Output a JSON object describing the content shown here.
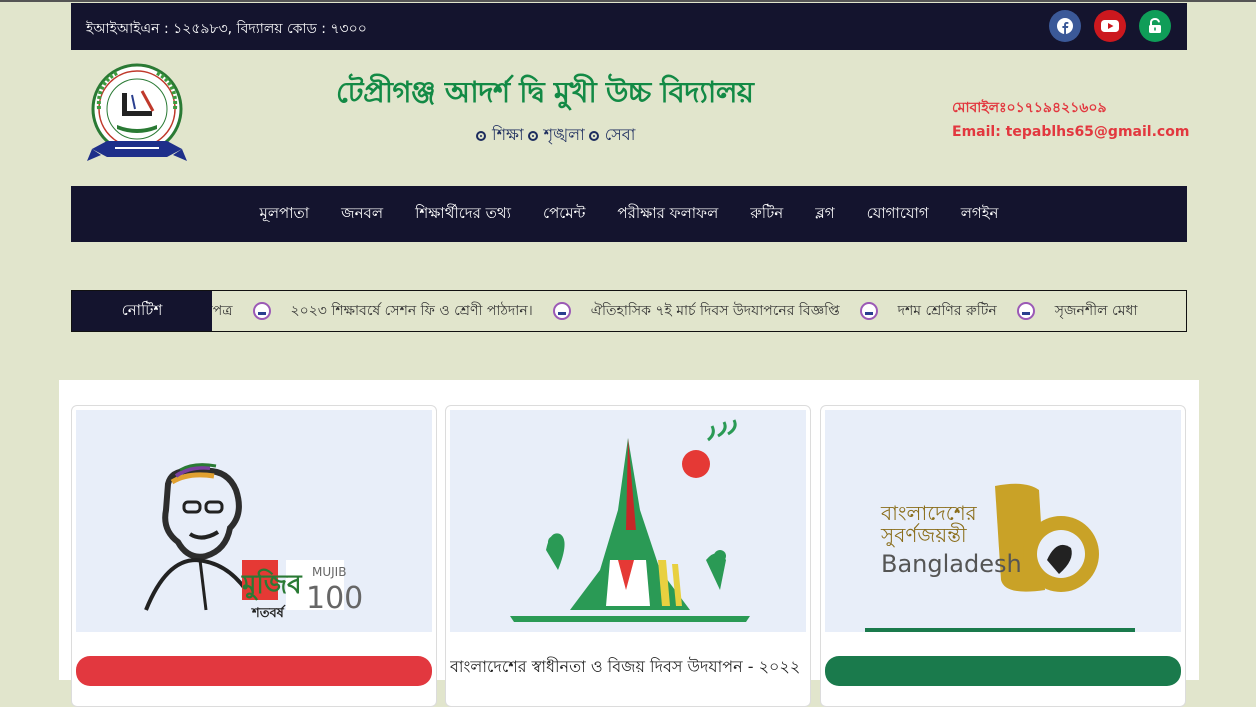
{
  "topbar": {
    "eiin_text": "ইআইআইএন : ১২৫৯৮৩, বিদ্যালয় কোড : ৭৩০০",
    "social": [
      {
        "icon": "facebook-icon",
        "color": "#3b5998"
      },
      {
        "icon": "youtube-icon",
        "color": "#cc181e"
      },
      {
        "icon": "unlock-icon",
        "color": "#0f9d58"
      }
    ]
  },
  "header": {
    "school_name": "টেপ্রীগঞ্জ আদর্শ দ্বি মুখী উচ্চ বিদ্যালয়",
    "motto": [
      "শিক্ষা",
      "শৃঙ্খলা",
      "সেবা"
    ],
    "mobile": "মোবাইলঃ০১৭১৯৪২১৬০৯",
    "email": "Email: tepablhs65@gmail.com"
  },
  "nav": {
    "items": [
      "মূলপাতা",
      "জনবল",
      "শিক্ষার্থীদের তথ্য",
      "পেমেন্ট",
      "পরীক্ষার ফলাফল",
      "রুটিন",
      "ব্লগ",
      "যোগাযোগ",
      "লগইন"
    ]
  },
  "notice": {
    "label": "নোটিশ",
    "items": [
      "রিপত্র",
      "২০২৩ শিক্ষাবর্ষে সেশন ফি ও শ্রেণী পাঠদান।",
      "ঐতিহাসিক ৭ই মার্চ দিবস উদযাপনের বিজ্ঞপ্তি",
      "দশম শ্রেণির রুটিন",
      "সৃজনশীল মেধা"
    ]
  },
  "cards": [
    {
      "image_text_1": "মুজিব",
      "image_text_2": "শতবর্ষ",
      "image_text_3": "MUJIB",
      "image_text_4": "100",
      "caption": ""
    },
    {
      "image_text_1": "",
      "caption": "বাংলাদেশের স্বাধীনতা ও বিজয় দিবস উদযাপন - ২০২২"
    },
    {
      "image_text_1": "বাংলাদেশের",
      "image_text_2": "সুবর্ণজয়ন্তী",
      "image_text_3": "Bangladesh",
      "image_text_4": "50",
      "caption": ""
    }
  ],
  "colors": {
    "primary": "#14142e",
    "accent_green": "#138a45",
    "accent_red": "#e2383f",
    "background": "#e1e5cc"
  }
}
